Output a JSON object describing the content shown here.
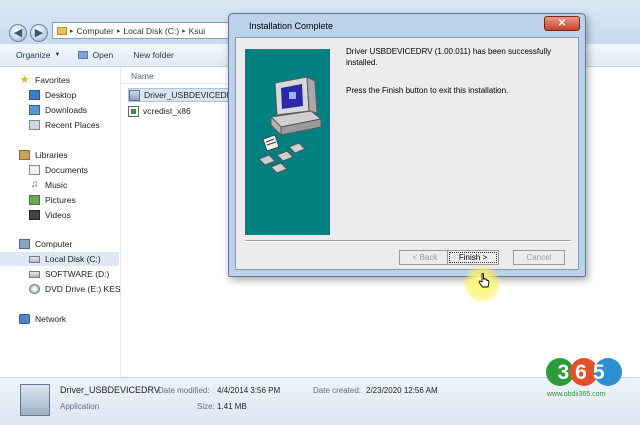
{
  "explorer": {
    "breadcrumb": [
      "Computer",
      "Local Disk (C:)",
      "Ksui"
    ],
    "toolbar": {
      "organize": "Organize",
      "open": "Open",
      "new_folder": "New folder"
    },
    "nav": {
      "favorites": "Favorites",
      "desktop": "Desktop",
      "downloads": "Downloads",
      "recent": "Recent Places",
      "libraries": "Libraries",
      "documents": "Documents",
      "music": "Music",
      "pictures": "Pictures",
      "videos": "Videos",
      "computer": "Computer",
      "local_disk": "Local Disk (C:)",
      "software": "SOFTWARE (D:)",
      "dvd": "DVD Drive (E:) KESS_",
      "network": "Network"
    },
    "column_name": "Name",
    "files": [
      "Driver_USBDEVICEDRV",
      "vcredist_x86"
    ],
    "details": {
      "name": "Driver_USBDEVICEDRV",
      "type": "Application",
      "modified_label": "Date modified:",
      "modified_value": "4/4/2014 3:56 PM",
      "created_label": "Date created:",
      "created_value": "2/23/2020 12:56 AM",
      "size_label": "Size:",
      "size_value": "1.41 MB"
    }
  },
  "dialog": {
    "title": "Installation Complete",
    "message": "Driver USBDEVICEDRV (1.00.011) has been successfully installed.",
    "instruction": "Press the Finish button to exit this installation.",
    "back_label": "< Back",
    "finish_label": "Finish >",
    "cancel_label": "Cancel"
  },
  "watermark": {
    "logo": "365",
    "url": "www.obdii365.com"
  },
  "colors": {
    "accent": "#bcd2ea",
    "art_bg": "#008080",
    "close": "#c7402b"
  },
  "icons": [
    "back-arrow-icon",
    "forward-arrow-icon",
    "folder-icon",
    "open-icon",
    "star-icon",
    "desktop-icon",
    "downloads-icon",
    "recent-places-icon",
    "library-icon",
    "documents-icon",
    "music-icon",
    "pictures-icon",
    "videos-icon",
    "computer-icon",
    "disk-icon",
    "dvd-icon",
    "network-icon",
    "installer-icon",
    "close-icon",
    "cursor-icon"
  ]
}
